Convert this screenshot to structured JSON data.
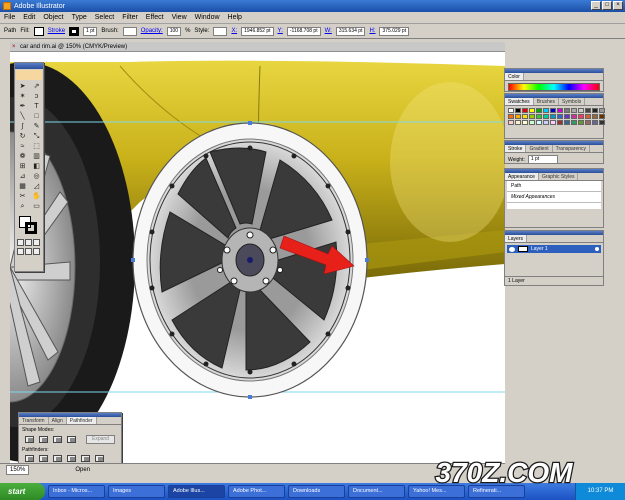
{
  "window": {
    "title": "Adobe Illustrator"
  },
  "menu": [
    "File",
    "Edit",
    "Object",
    "Type",
    "Select",
    "Filter",
    "Effect",
    "View",
    "Window",
    "Help"
  ],
  "controlbar": {
    "selection_label": "Path",
    "fill_label": "Fill:",
    "stroke_label": "Stroke",
    "stroke_weight": "1 pt",
    "brush_label": "Brush:",
    "opacity_label": "Opacity:",
    "opacity_value": "100",
    "opacity_unit": "%",
    "style_label": "Style:",
    "x_label": "X:",
    "x_value": "1946.852 pt",
    "y_label": "Y:",
    "y_value": "-1168.708 pt",
    "w_label": "W:",
    "w_value": "315.634 pt",
    "h_label": "H:",
    "h_value": "375.029 pt"
  },
  "document": {
    "tab_title": "car and rim.ai @ 150% (CMYK/Preview)"
  },
  "panels": {
    "color": {
      "tab": "Color"
    },
    "swatches": {
      "tabs": [
        "Swatches",
        "Brushes",
        "Symbols"
      ]
    },
    "stroke": {
      "tabs": [
        "Stroke",
        "Gradient",
        "Transparency"
      ],
      "weight_label": "Weight:",
      "weight_value": "1 pt"
    },
    "appearance": {
      "tabs": [
        "Appearance",
        "Graphic Styles"
      ],
      "item": "Path",
      "sub": "Mixed Appearances"
    },
    "layers": {
      "tab": "Layers",
      "layer_name": "Layer 1",
      "footer": "1 Layer"
    },
    "pathfinder": {
      "tabs": [
        "Transform",
        "Align",
        "Pathfinder"
      ],
      "shape_modes_label": "Shape Modes:",
      "pathfinders_label": "Pathfinders:",
      "expand_label": "Expand"
    }
  },
  "status": {
    "zoom": "150%",
    "mode": "Open"
  },
  "taskbar": {
    "start": "start",
    "tasks": [
      "Inbox - Micros...",
      "Images",
      "Adobe Illus...",
      "Adobe Phot...",
      "Downloads",
      "Document...",
      "Yahoo! Mes...",
      "Refinerati..."
    ],
    "time": "10:37 PM"
  },
  "watermark": {
    "text": "370Z.COM"
  },
  "colors": {
    "car_body": "#c9b11a",
    "tire": "#1a1a1a",
    "arrow": "#e8201a",
    "selection": "#4a7bd8"
  }
}
